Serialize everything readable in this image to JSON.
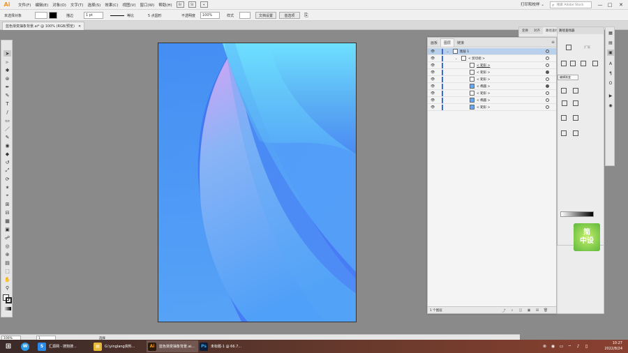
{
  "app": {
    "logo": "Ai"
  },
  "menu": [
    "文件(F)",
    "编辑(E)",
    "对象(O)",
    "文字(T)",
    "选择(S)",
    "效果(C)",
    "视图(V)",
    "窗口(W)",
    "帮助(H)"
  ],
  "menubar_icons": [
    "Br",
    "St"
  ],
  "workspace": "打印和校样 ⌄",
  "search": {
    "placeholder": "搜索 Adobe Stock"
  },
  "window_controls": [
    "—",
    "□",
    "✕"
  ],
  "control_bar": {
    "selection_state": "未选择对象",
    "stroke_label": "描边",
    "stroke_weight": "1 pt",
    "profile_label": "等比",
    "brush_label": "5 点圆形",
    "opacity_label": "不透明度",
    "opacity_value": "100%",
    "style_label": "样式",
    "doc_setup_button": "文档设置",
    "preferences_button": "首选项"
  },
  "document_tab": {
    "title": "蓝色渐变抽象背景.ai* @ 100% (RGB/预览)",
    "close": "✕"
  },
  "tools": [
    "➤",
    "▹",
    "✱",
    "⊛",
    "✒",
    "✎",
    "T",
    "/",
    "▭",
    "／",
    "✎",
    "◉",
    "◆",
    "↺",
    "⤢",
    "⟳",
    "✶",
    "⌖",
    "⊞",
    "⊟",
    "▦",
    "▣",
    "☍",
    "◎",
    "⊕",
    "▤",
    "⬚",
    "✋",
    "⚲"
  ],
  "properties_panel": {
    "tabs": [
      "变换",
      "对齐",
      "路径查找器"
    ]
  },
  "layers_panel": {
    "tabs": [
      "画板",
      "图层",
      "链接"
    ],
    "menu_icon": "≡",
    "rows": [
      {
        "name": "图层 1",
        "level": 0,
        "selected": true,
        "thumb": "layer"
      },
      {
        "name": "< 剪切组 >",
        "level": 1,
        "selected": false,
        "thumb": "group"
      },
      {
        "name": "< 矩形 >",
        "level": 2,
        "selected": false,
        "thumb": "plain",
        "underline": true
      },
      {
        "name": "< 矩形 >",
        "level": 2,
        "selected": false,
        "thumb": "plain"
      },
      {
        "name": "< 矩形 >",
        "level": 2,
        "selected": false,
        "thumb": "plain"
      },
      {
        "name": "< 椭圆 >",
        "level": 2,
        "selected": false,
        "thumb": "blue"
      },
      {
        "name": "< 矩形 >",
        "level": 2,
        "selected": false,
        "thumb": "plain"
      },
      {
        "name": "< 椭圆 >",
        "level": 2,
        "selected": false,
        "thumb": "blue"
      },
      {
        "name": "< 矩形 >",
        "level": 2,
        "selected": false,
        "thumb": "blue"
      }
    ],
    "footer_count": "1 个图层"
  },
  "pathfinder_panel": {
    "title": "路径查找器",
    "expand_button": "扩展",
    "button_text": "编辑渐变"
  },
  "logo_watermark": {
    "line1": "简",
    "line2": "中设"
  },
  "status_bar": {
    "zoom": "100%",
    "artboard": "1",
    "mode": "选择"
  },
  "taskbar": {
    "items": [
      {
        "label": "汇源网 - 搜狗搜...",
        "icon_color": "#2a8ae8",
        "icon_text": "S"
      },
      {
        "label": "G:\\yinglang资料...",
        "icon_color": "#e8b83a",
        "icon_text": "▤"
      },
      {
        "label": "蓝色渐变抽象背景.ai...",
        "icon_color": "#2c1a08",
        "icon_text": "Ai"
      },
      {
        "label": "未标题-1 @ 66.7...",
        "icon_color": "#0a1e3a",
        "icon_text": "Ps"
      }
    ],
    "time": "10:27",
    "date": "2022/8/24"
  },
  "colors": {
    "artboard_base": "#4a8af4",
    "accent_light": "#6ed8ff",
    "accent_purple": "#c8a0f8"
  }
}
